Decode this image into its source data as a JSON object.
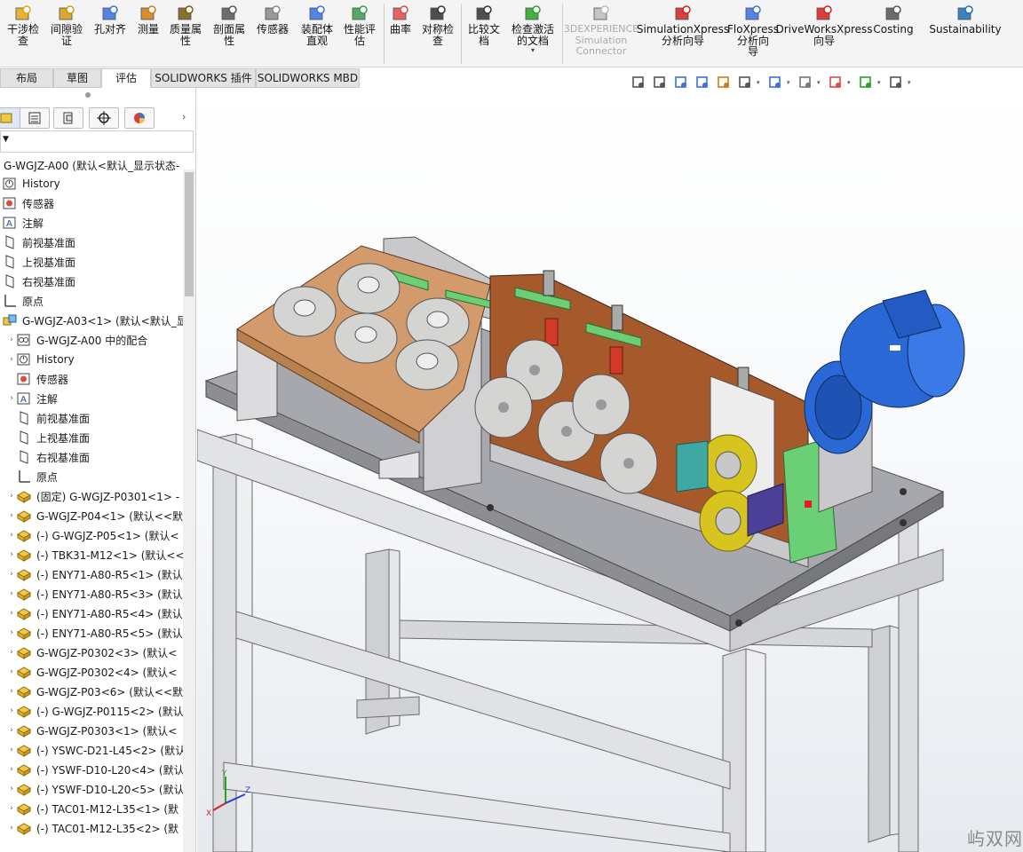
{
  "ribbon": {
    "buttons": [
      {
        "label": "干涉检\n查",
        "icon": "interference-check-icon"
      },
      {
        "label": "间隙验\n证",
        "icon": "clearance-verification-icon"
      },
      {
        "label": "孔对齐",
        "icon": "hole-alignment-icon"
      },
      {
        "label": "测量",
        "icon": "measure-icon"
      },
      {
        "label": "质量属\n性",
        "icon": "mass-properties-icon"
      },
      {
        "label": "剖面属\n性",
        "icon": "section-properties-icon"
      },
      {
        "label": "传感器",
        "icon": "sensor-icon"
      },
      {
        "label": "装配体\n直观",
        "icon": "assembly-visualization-icon"
      },
      {
        "label": "性能评\n估",
        "icon": "performance-evaluation-icon"
      },
      {
        "label": "曲率",
        "icon": "curvature-icon"
      },
      {
        "label": "对称检\n查",
        "icon": "symmetry-check-icon"
      },
      {
        "label": "比较文\n档",
        "icon": "compare-documents-icon"
      },
      {
        "label": "检查激活\n的文档",
        "icon": "check-active-document-icon"
      },
      {
        "label": "3DEXPERIENCE\nSimulation\nConnector",
        "icon": "3dexperience-icon"
      },
      {
        "label": "SimulationXpress\n分析向导",
        "icon": "simulationxpress-icon"
      },
      {
        "label": "FloXpress\n分析向\n导",
        "icon": "floxpress-icon"
      },
      {
        "label": "DriveWorksXpress\n向导",
        "icon": "driveworksxpress-icon"
      },
      {
        "label": "Costing",
        "icon": "costing-icon"
      },
      {
        "label": "Sustainability",
        "icon": "sustainability-icon"
      }
    ],
    "dropdown_mark": "▾"
  },
  "tabs": [
    "布局",
    "草图",
    "评估",
    "SOLIDWORKS 插件",
    "SOLIDWORKS MBD"
  ],
  "active_tab": "评估",
  "view_toolbar": {
    "icons": [
      "zoom-to-fit-icon",
      "zoom-to-area-icon",
      "previous-view-icon",
      "section-view-icon",
      "dynamic-annotation-icon",
      "view-orientation-icon",
      "display-style-icon",
      "hide-show-items-icon",
      "edit-appearance-icon",
      "apply-scene-icon",
      "view-settings-icon"
    ]
  },
  "feature_manager": {
    "root_label": "G-WGJZ-A00  (默认<默认_显示状态-",
    "expand_arrow": "›",
    "filter_symbol": "▼",
    "tree": [
      {
        "label": "History",
        "icon": "history-icon",
        "indent": 0,
        "expander": false
      },
      {
        "label": "传感器",
        "icon": "sensor-icon",
        "indent": 0,
        "expander": false
      },
      {
        "label": "注解",
        "icon": "annotations-icon",
        "indent": 0,
        "expander": false
      },
      {
        "label": "前视基准面",
        "icon": "plane-icon",
        "indent": 0,
        "expander": false
      },
      {
        "label": "上视基准面",
        "icon": "plane-icon",
        "indent": 0,
        "expander": false
      },
      {
        "label": "右视基准面",
        "icon": "plane-icon",
        "indent": 0,
        "expander": false
      },
      {
        "label": "原点",
        "icon": "origin-icon",
        "indent": 0,
        "expander": false
      },
      {
        "label": "G-WGJZ-A03<1> (默认<默认_显",
        "icon": "subassembly-icon",
        "indent": 0,
        "expander": false
      },
      {
        "label": "G-WGJZ-A00 中的配合",
        "icon": "mates-icon",
        "indent": 1,
        "expander": true
      },
      {
        "label": "History",
        "icon": "history-icon",
        "indent": 1,
        "expander": true
      },
      {
        "label": "传感器",
        "icon": "sensor-icon",
        "indent": 1,
        "expander": false
      },
      {
        "label": "注解",
        "icon": "annotations-icon",
        "indent": 1,
        "expander": true
      },
      {
        "label": "前视基准面",
        "icon": "plane-icon",
        "indent": 1,
        "expander": false
      },
      {
        "label": "上视基准面",
        "icon": "plane-icon",
        "indent": 1,
        "expander": false
      },
      {
        "label": "右视基准面",
        "icon": "plane-icon",
        "indent": 1,
        "expander": false
      },
      {
        "label": "原点",
        "icon": "origin-icon",
        "indent": 1,
        "expander": false
      },
      {
        "label": "(固定) G-WGJZ-P0301<1> -",
        "icon": "part-icon",
        "indent": 1,
        "expander": true
      },
      {
        "label": "G-WGJZ-P04<1> (默认<<默",
        "icon": "part-icon",
        "indent": 1,
        "expander": true
      },
      {
        "label": "(-) G-WGJZ-P05<1> (默认<",
        "icon": "part-icon",
        "indent": 1,
        "expander": true
      },
      {
        "label": "(-) TBK31-M12<1> (默认<<",
        "icon": "part-icon",
        "indent": 1,
        "expander": true
      },
      {
        "label": "(-) ENY71-A80-R5<1> (默认",
        "icon": "part-icon",
        "indent": 1,
        "expander": true
      },
      {
        "label": "(-) ENY71-A80-R5<3> (默认",
        "icon": "part-icon",
        "indent": 1,
        "expander": true
      },
      {
        "label": "(-) ENY71-A80-R5<4> (默认",
        "icon": "part-icon",
        "indent": 1,
        "expander": true
      },
      {
        "label": "(-) ENY71-A80-R5<5> (默认",
        "icon": "part-icon",
        "indent": 1,
        "expander": true
      },
      {
        "label": "G-WGJZ-P0302<3> (默认<",
        "icon": "part-icon",
        "indent": 1,
        "expander": true
      },
      {
        "label": "G-WGJZ-P0302<4> (默认<",
        "icon": "part-icon",
        "indent": 1,
        "expander": true
      },
      {
        "label": "G-WGJZ-P03<6> (默认<<默",
        "icon": "part-icon",
        "indent": 1,
        "expander": true
      },
      {
        "label": "(-) G-WGJZ-P0115<2> (默认",
        "icon": "part-icon",
        "indent": 1,
        "expander": true
      },
      {
        "label": "G-WGJZ-P0303<1> (默认<",
        "icon": "part-icon",
        "indent": 1,
        "expander": true
      },
      {
        "label": "(-) YSWC-D21-L45<2> (默认",
        "icon": "part-icon",
        "indent": 1,
        "expander": true
      },
      {
        "label": "(-) YSWF-D10-L20<4> (默认",
        "icon": "part-icon",
        "indent": 1,
        "expander": true
      },
      {
        "label": "(-) YSWF-D10-L20<5> (默认",
        "icon": "part-icon",
        "indent": 1,
        "expander": true
      },
      {
        "label": "(-) TAC01-M12-L35<1> (默",
        "icon": "part-icon",
        "indent": 1,
        "expander": true
      },
      {
        "label": "(-) TAC01-M12-L35<2> (默",
        "icon": "part-icon",
        "indent": 1,
        "expander": true
      }
    ]
  },
  "triad": {
    "x": "X",
    "y": "Y",
    "z": "Z"
  },
  "watermark": "屿双网",
  "colors": {
    "frame": "#d9dadd",
    "tabletop": "#9b9da3",
    "copper_plate": "#d39a6b",
    "brown_plate": "#a65a2c",
    "motor_blue": "#2a68d6",
    "roller_yellow": "#d8c41e",
    "bracket_green": "#6bcf75",
    "wheel_grey": "#d4d4d2"
  }
}
